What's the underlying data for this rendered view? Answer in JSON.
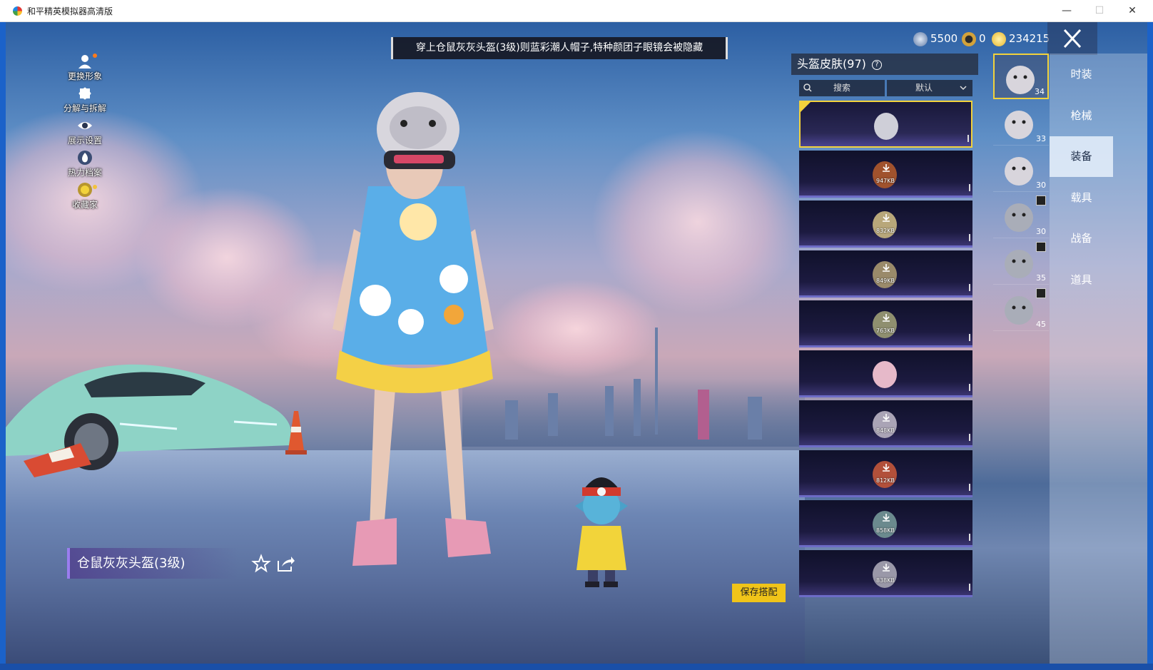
{
  "window": {
    "title": "和平精英模拟器高清版",
    "controls": [
      "—",
      "☐",
      "✕"
    ]
  },
  "side_menu": [
    {
      "label": "更换形象",
      "icon": "person-icon"
    },
    {
      "label": "分解与拆解",
      "icon": "puzzle-icon"
    },
    {
      "label": "展示设置",
      "icon": "eye-icon"
    },
    {
      "label": "热力档案",
      "icon": "flame-icon"
    },
    {
      "label": "收藏家",
      "icon": "medal-icon"
    }
  ],
  "banner": {
    "text": "穿上仓鼠灰灰头盔(3级)则蓝彩潮人帽子,特种颜团子眼镜会被隐藏"
  },
  "currency": [
    {
      "icon": "globe-coin-icon",
      "value": "5500",
      "color": "#8aa2c8"
    },
    {
      "icon": "medal-coin-icon",
      "value": "0",
      "color": "#d3a23a"
    },
    {
      "icon": "gold-coin-icon",
      "value": "234215",
      "color": "#e8c43a"
    }
  ],
  "panel": {
    "title": "头盔皮肤",
    "count": "(97)",
    "search_label": "搜索",
    "sort_label": "默认"
  },
  "skin_list": [
    {
      "size": "",
      "selected": true,
      "color": "#cfcfd8"
    },
    {
      "size": "947KB",
      "selected": false,
      "color": "#a0522d"
    },
    {
      "size": "832KB",
      "selected": false,
      "color": "#b8a77a"
    },
    {
      "size": "849KB",
      "selected": false,
      "color": "#9a8a6a"
    },
    {
      "size": "763KB",
      "selected": false,
      "color": "#8f8f6f"
    },
    {
      "size": "",
      "selected": false,
      "color": "#e6b9c9"
    },
    {
      "size": "848KB",
      "selected": false,
      "color": "#aaa4b6"
    },
    {
      "size": "812KB",
      "selected": false,
      "color": "#b2503a"
    },
    {
      "size": "858KB",
      "selected": false,
      "color": "#6b8a8e"
    },
    {
      "size": "838KB",
      "selected": false,
      "color": "#9a98a8"
    }
  ],
  "thumbnails": [
    {
      "num": "34",
      "selected": true,
      "badge": false
    },
    {
      "num": "33",
      "selected": false,
      "badge": false
    },
    {
      "num": "30",
      "selected": false,
      "badge": false
    },
    {
      "num": "30",
      "selected": false,
      "badge": true
    },
    {
      "num": "35",
      "selected": false,
      "badge": true
    },
    {
      "num": "45",
      "selected": false,
      "badge": true
    }
  ],
  "tabs": [
    {
      "label": "时装",
      "active": false
    },
    {
      "label": "枪械",
      "active": false
    },
    {
      "label": "装备",
      "active": true
    },
    {
      "label": "载具",
      "active": false
    },
    {
      "label": "战备",
      "active": false
    },
    {
      "label": "道具",
      "active": false
    }
  ],
  "selected_item": {
    "name": "仓鼠灰灰头盔(3级)"
  },
  "buttons": {
    "save": "保存搭配"
  },
  "colors": {
    "accent_gold": "#f2d23c",
    "selected_border": "#f2d23c",
    "list_bottom": "#6d6cc7"
  }
}
